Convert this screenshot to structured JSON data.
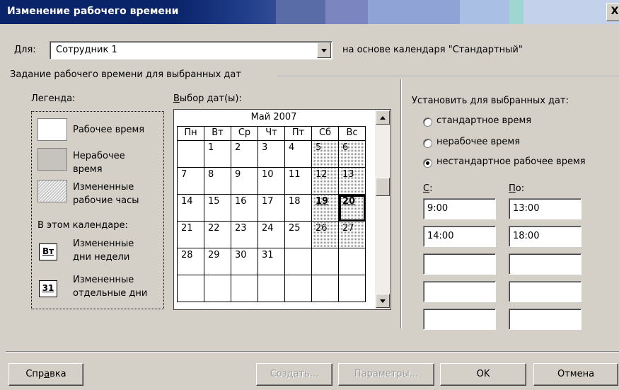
{
  "window": {
    "title": "Изменение рабочего времени",
    "close_label": "X"
  },
  "for_row": {
    "label": "Для:",
    "selected": "Сотрудник 1",
    "based_on": "на основе календаря \"Стандартный\""
  },
  "section_title": "Задание рабочего времени для выбранных дат",
  "legend": {
    "title": "Легенда:",
    "working": "Рабочее время",
    "nonworking_1": "Нерабочее",
    "nonworking_2": "время",
    "modified_1": "Измененные",
    "modified_2": "рабочие часы",
    "in_calendar": "В этом календаре:",
    "weekday_icon": "Вт",
    "weekday_1": "Измененные",
    "weekday_2": "дни недели",
    "date_icon": "31",
    "date_1": "Измененные",
    "date_2": "отдельные дни"
  },
  "calendar": {
    "title": "Выбор дат(ы):",
    "month": "Май 2007",
    "weekdays": [
      "Пн",
      "Вт",
      "Ср",
      "Чт",
      "Пт",
      "Сб",
      "Вс"
    ],
    "weeks": [
      [
        "",
        "1",
        "2",
        "3",
        "4",
        "5",
        "6"
      ],
      [
        "7",
        "8",
        "9",
        "10",
        "11",
        "12",
        "13"
      ],
      [
        "14",
        "15",
        "16",
        "17",
        "18",
        "19",
        "20"
      ],
      [
        "21",
        "22",
        "23",
        "24",
        "25",
        "26",
        "27"
      ],
      [
        "28",
        "29",
        "30",
        "31",
        "",
        "",
        ""
      ],
      [
        "",
        "",
        "",
        "",
        "",
        "",
        ""
      ]
    ],
    "selected_date": "20",
    "modified_dates": [
      "19",
      "20"
    ]
  },
  "set_for_dates": {
    "title": "Установить для выбранных дат:",
    "options": [
      "стандартное время",
      "нерабочее время",
      "нестандартное рабочее время"
    ],
    "selected_option": "нестандартное рабочее время",
    "from_label": "С:",
    "to_label": "По:",
    "rows": [
      {
        "from": "9:00",
        "to": "13:00"
      },
      {
        "from": "14:00",
        "to": "18:00"
      },
      {
        "from": "",
        "to": ""
      },
      {
        "from": "",
        "to": ""
      },
      {
        "from": "",
        "to": ""
      }
    ]
  },
  "buttons": {
    "help": "Справка",
    "create": "Создать...",
    "params": "Параметры...",
    "ok": "OK",
    "cancel": "Отмена"
  }
}
